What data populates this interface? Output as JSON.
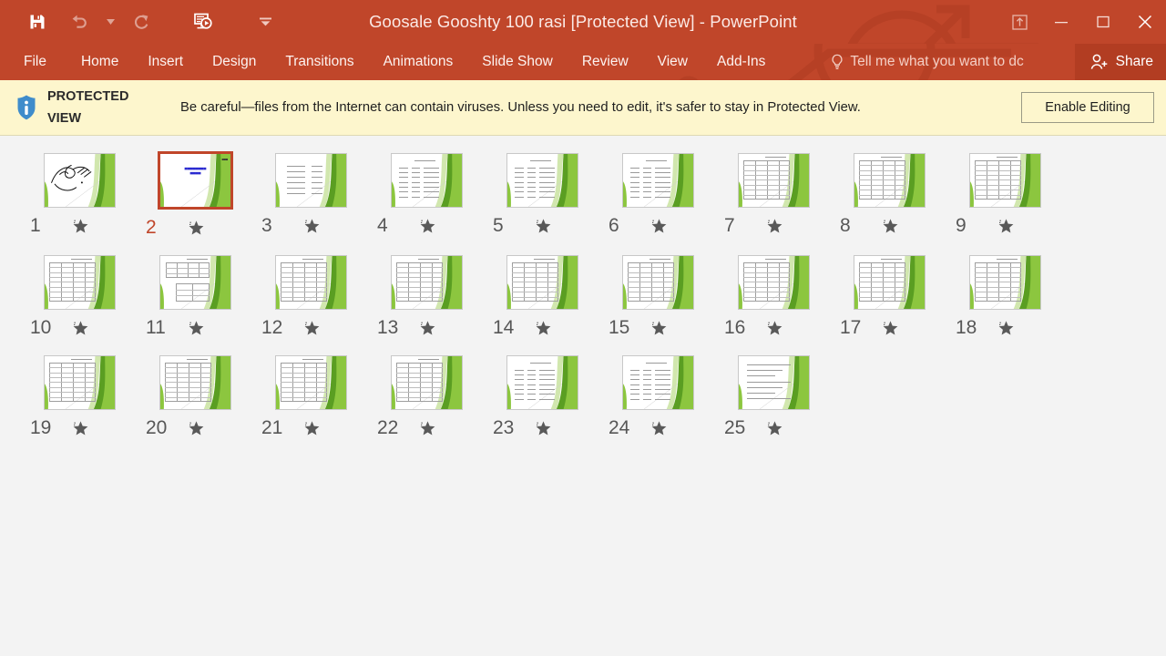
{
  "window": {
    "title": "Goosale Gooshty 100 rasi  [Protected View] - PowerPoint",
    "accent_color": "#c0462a",
    "share_bg": "#b23d22"
  },
  "quick_access": {
    "items": [
      {
        "name": "save",
        "icon": "save-icon",
        "enabled": true
      },
      {
        "name": "undo",
        "icon": "undo-icon",
        "enabled": false
      },
      {
        "name": "undo-dropdown",
        "icon": "chevron-down-icon",
        "enabled": false
      },
      {
        "name": "redo",
        "icon": "redo-icon",
        "enabled": false
      },
      {
        "name": "start-slideshow",
        "icon": "slideshow-icon",
        "enabled": true
      },
      {
        "name": "customize-quick-access-toolbar",
        "icon": "chevron-down-icon",
        "enabled": true
      }
    ]
  },
  "window_controls": {
    "ribbon_display_options": "ribbon-display-options-icon",
    "minimize": "minimize-icon",
    "restore": "restore-icon",
    "close": "close-icon"
  },
  "ribbon": {
    "tabs": [
      {
        "label": "File"
      },
      {
        "label": "Home"
      },
      {
        "label": "Insert"
      },
      {
        "label": "Design"
      },
      {
        "label": "Transitions"
      },
      {
        "label": "Animations"
      },
      {
        "label": "Slide Show"
      },
      {
        "label": "Review"
      },
      {
        "label": "View"
      },
      {
        "label": "Add-Ins"
      }
    ],
    "tell_me": "Tell me what you want to dc",
    "share": "Share"
  },
  "protected_view": {
    "label_line1": "PROTECTED",
    "label_line2": "VIEW",
    "message": "Be careful—files from the Internet can contain viruses. Unless you need to edit, it's safer to stay in Protected View.",
    "enable_button": "Enable Editing",
    "bar_color": "#fdf6cd"
  },
  "slides": [
    {
      "number": "1",
      "type": "calligraphy",
      "selected": false,
      "animated": true
    },
    {
      "number": "2",
      "type": "title",
      "selected": true,
      "animated": true
    },
    {
      "number": "3",
      "type": "list",
      "selected": false,
      "animated": true
    },
    {
      "number": "4",
      "type": "rows",
      "selected": false,
      "animated": true
    },
    {
      "number": "5",
      "type": "rows",
      "selected": false,
      "animated": true
    },
    {
      "number": "6",
      "type": "rows",
      "selected": false,
      "animated": true
    },
    {
      "number": "7",
      "type": "table",
      "selected": false,
      "animated": true
    },
    {
      "number": "8",
      "type": "table",
      "selected": false,
      "animated": true
    },
    {
      "number": "9",
      "type": "table",
      "selected": false,
      "animated": true
    },
    {
      "number": "10",
      "type": "table",
      "selected": false,
      "animated": true
    },
    {
      "number": "11",
      "type": "table2",
      "selected": false,
      "animated": true
    },
    {
      "number": "12",
      "type": "table",
      "selected": false,
      "animated": true
    },
    {
      "number": "13",
      "type": "table",
      "selected": false,
      "animated": true
    },
    {
      "number": "14",
      "type": "table",
      "selected": false,
      "animated": true
    },
    {
      "number": "15",
      "type": "table",
      "selected": false,
      "animated": true
    },
    {
      "number": "16",
      "type": "table",
      "selected": false,
      "animated": true
    },
    {
      "number": "17",
      "type": "table",
      "selected": false,
      "animated": true
    },
    {
      "number": "18",
      "type": "table",
      "selected": false,
      "animated": true
    },
    {
      "number": "19",
      "type": "table",
      "selected": false,
      "animated": true
    },
    {
      "number": "20",
      "type": "table",
      "selected": false,
      "animated": true
    },
    {
      "number": "21",
      "type": "table",
      "selected": false,
      "animated": true
    },
    {
      "number": "22",
      "type": "table",
      "selected": false,
      "animated": true
    },
    {
      "number": "23",
      "type": "rows",
      "selected": false,
      "animated": true
    },
    {
      "number": "24",
      "type": "rows",
      "selected": false,
      "animated": true
    },
    {
      "number": "25",
      "type": "text",
      "selected": false,
      "animated": true
    }
  ],
  "slide_theme": {
    "accent_green_dark": "#5a9e22",
    "accent_green_mid": "#8cc63f",
    "accent_green_light": "#c9e3a0",
    "title_color": "#2a2ad0"
  }
}
